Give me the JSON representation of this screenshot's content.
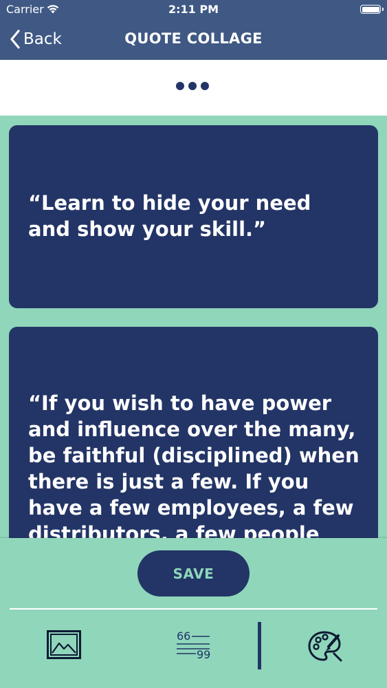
{
  "status_bar": {
    "carrier": "Carrier",
    "time": "2:11 PM"
  },
  "nav": {
    "back_label": "Back",
    "title": "QUOTE COLLAGE"
  },
  "quotes": [
    "“Learn to hide your need and show your skill.”",
    "“If you wish to have power and influence over the many, be faithful (disciplined) when there is just a few. If you have a few employees, a few distributors, a few people"
  ],
  "bottom": {
    "save_label": "SAVE"
  },
  "colors": {
    "nav_bg": "#3f5984",
    "background": "#8fd6bb",
    "card_bg": "#233566",
    "accent_text": "#8fd6bb"
  },
  "icons": {
    "back": "chevron-left-icon",
    "more": "more-dots-icon",
    "tool_image": "image-icon",
    "tool_quote": "quote-text-icon",
    "tool_palette": "palette-brush-icon"
  }
}
